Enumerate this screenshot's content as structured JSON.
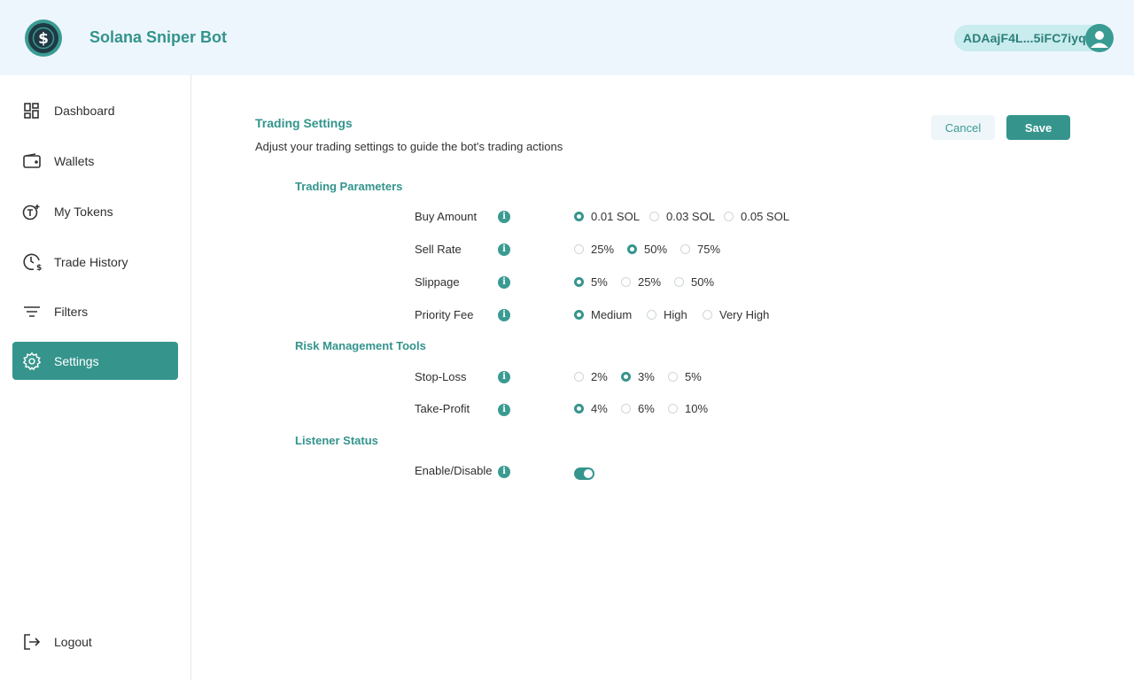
{
  "header": {
    "app_title": "Solana Sniper Bot",
    "account": "ADAajF4L...5iFC7iyq",
    "brand_color": "#35958d"
  },
  "sidebar": {
    "items": [
      {
        "label": "Dashboard",
        "icon": "dashboard-icon"
      },
      {
        "label": "Wallets",
        "icon": "wallet-icon"
      },
      {
        "label": "My Tokens",
        "icon": "token-icon"
      },
      {
        "label": "Trade History",
        "icon": "history-icon"
      },
      {
        "label": "Filters",
        "icon": "filter-icon"
      },
      {
        "label": "Settings",
        "icon": "gear-icon",
        "active": true
      }
    ],
    "logout": {
      "label": "Logout",
      "icon": "logout-icon"
    }
  },
  "main": {
    "title": "Trading Settings",
    "description": "Adjust your trading settings to guide the bot's trading actions",
    "cancel_label": "Cancel",
    "save_label": "Save"
  },
  "sections": {
    "trading": {
      "title": "Trading Parameters",
      "buy_amount": {
        "label": "Buy Amount",
        "options": [
          "0.01 SOL",
          "0.03 SOL",
          "0.05 SOL"
        ],
        "selected": "0.01 SOL"
      },
      "sell_rate": {
        "label": "Sell Rate",
        "options": [
          "25%",
          "50%",
          "75%"
        ],
        "selected": "50%"
      },
      "slippage": {
        "label": "Slippage",
        "options": [
          "5%",
          "25%",
          "50%"
        ],
        "selected": "5%"
      },
      "priority_fee": {
        "label": "Priority Fee",
        "options": [
          "Medium",
          "High",
          "Very High"
        ],
        "selected": "Medium"
      }
    },
    "risk": {
      "title": "Risk Management Tools",
      "stop_loss": {
        "label": "Stop-Loss",
        "options": [
          "2%",
          "3%",
          "5%"
        ],
        "selected": "3%"
      },
      "take_profit": {
        "label": "Take-Profit",
        "options": [
          "4%",
          "6%",
          "10%"
        ],
        "selected": "4%"
      }
    },
    "listener": {
      "title": "Listener Status",
      "toggle": {
        "label": "Enable/Disable",
        "enabled": true
      }
    }
  }
}
